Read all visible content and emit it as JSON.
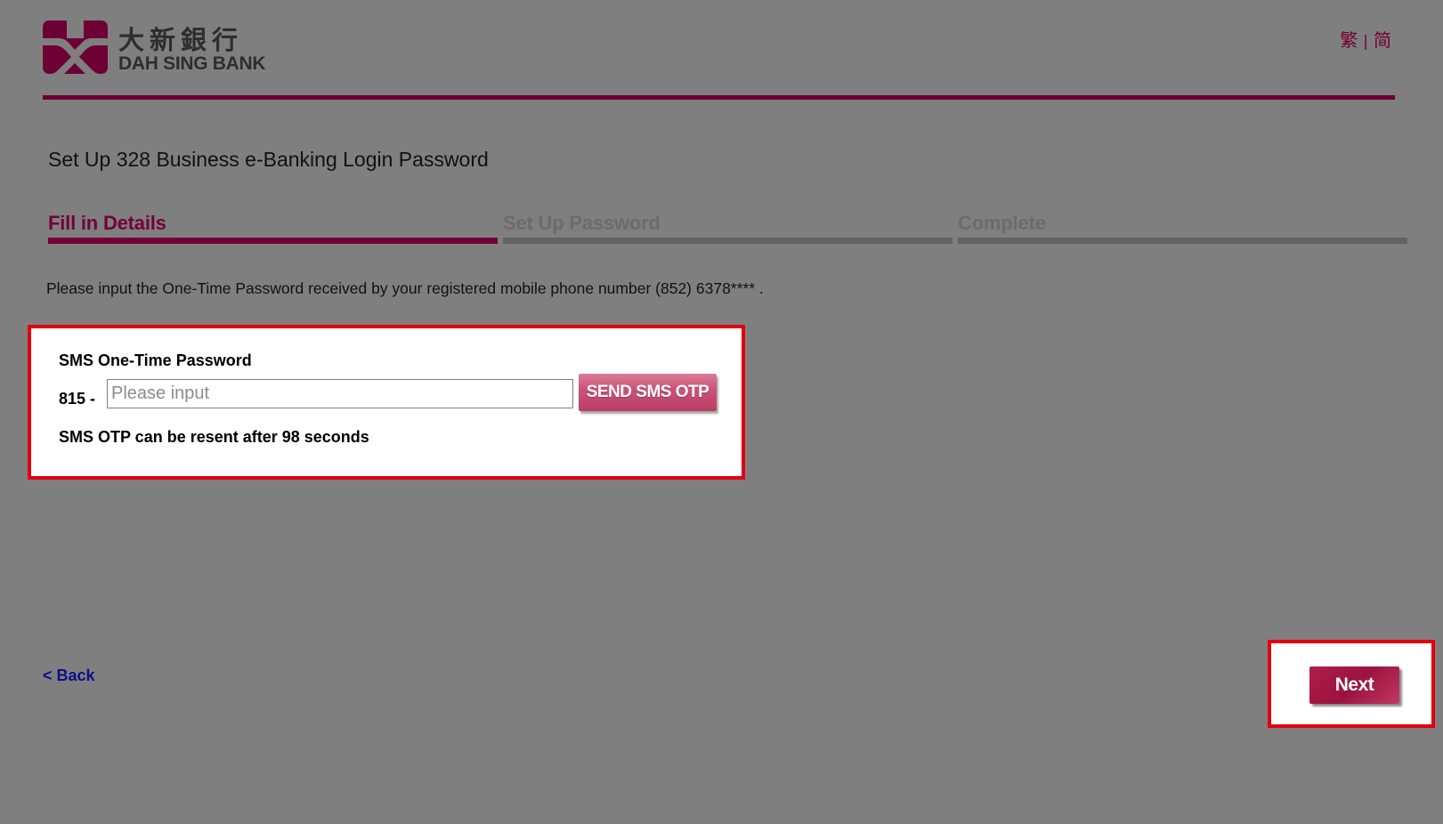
{
  "brand": {
    "name_zh": "大新銀行",
    "name_en": "DAH SING BANK",
    "color": "#70002e"
  },
  "language": {
    "traditional": "繁",
    "separator": "|",
    "simplified": "简"
  },
  "page": {
    "title": "Set Up 328 Business e-Banking Login Password"
  },
  "steps": [
    {
      "label": "Fill in Details",
      "state": "active"
    },
    {
      "label": "Set Up Password",
      "state": "inactive"
    },
    {
      "label": "Complete",
      "state": "inactive"
    }
  ],
  "instruction": "Please input the One-Time Password received by your registered mobile phone number (852) 6378**** .",
  "otp": {
    "title": "SMS One-Time Password",
    "prefix": "815 -",
    "placeholder": "Please input",
    "value": "",
    "send_label": "SEND SMS OTP",
    "resend_text": "SMS OTP can be resent after 98 seconds"
  },
  "nav": {
    "back_label": "< Back",
    "next_label": "Next"
  },
  "colors": {
    "background": "#7f7f7f",
    "accent": "#73003a",
    "highlight": "#e20010",
    "inactive_step": "#636363"
  }
}
